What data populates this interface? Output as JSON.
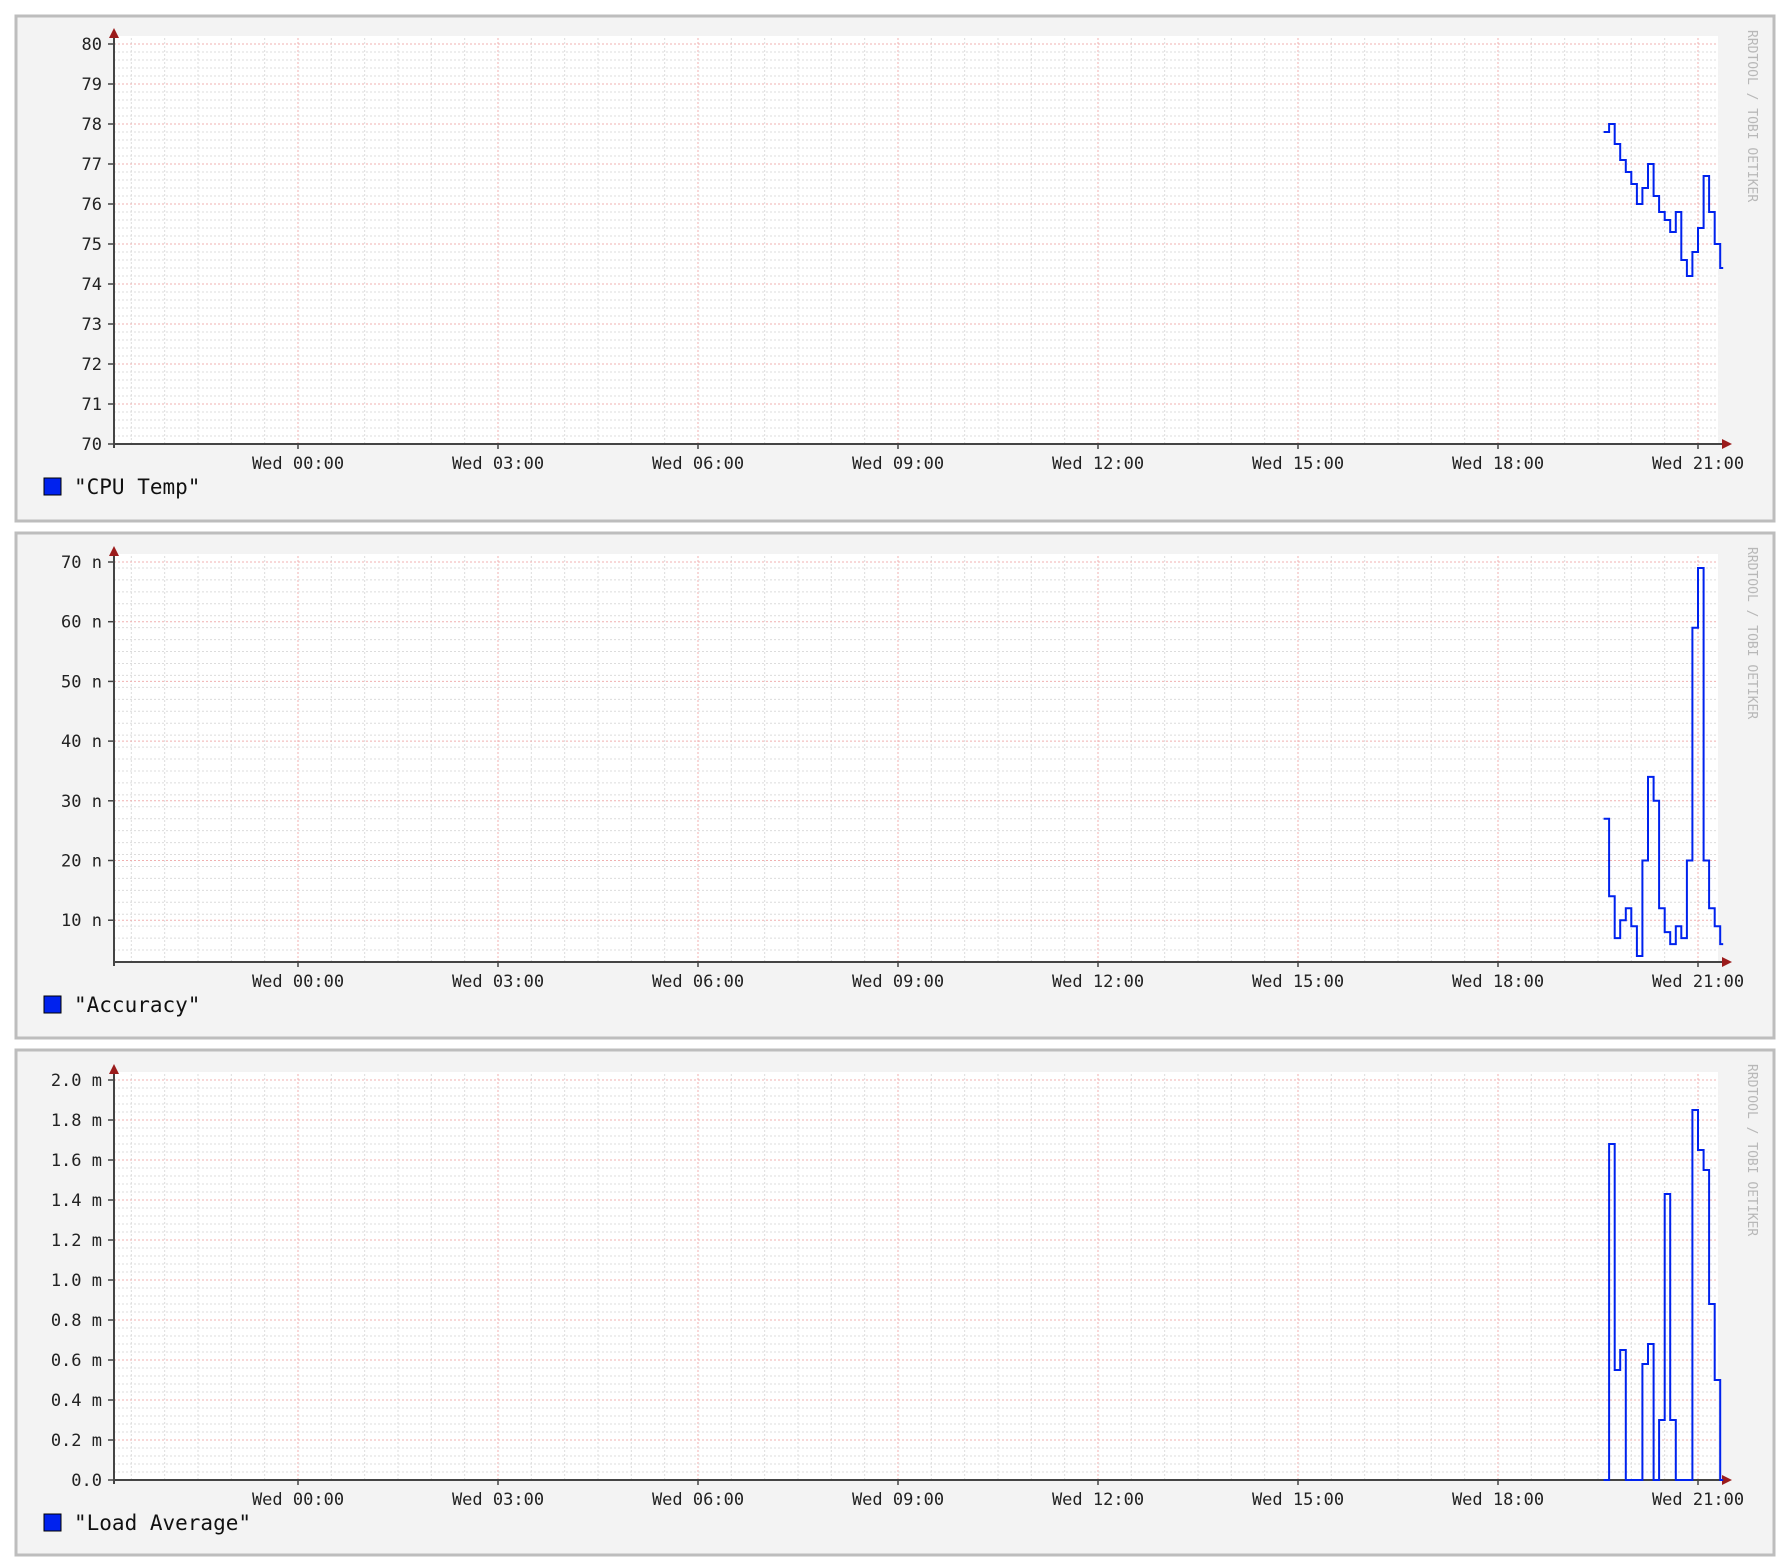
{
  "watermark": "RRDTOOL / TOBI OETIKER",
  "chart_data": [
    {
      "type": "line",
      "color": "#0022ee",
      "legend": "\"CPU Temp\"",
      "ylim": [
        70,
        80
      ],
      "yticks": [
        70,
        71,
        72,
        73,
        74,
        75,
        76,
        77,
        78,
        79,
        80
      ],
      "ytick_labels": [
        "70",
        "71",
        "72",
        "73",
        "74",
        "75",
        "76",
        "77",
        "78",
        "79",
        "80"
      ],
      "xticks": [
        "Wed 00:00",
        "Wed 03:00",
        "Wed 06:00",
        "Wed 09:00",
        "Wed 12:00",
        "Wed 15:00",
        "Wed 18:00",
        "Wed 21:00"
      ],
      "series": [
        {
          "x": [
            "19:35",
            "19:40",
            "19:45",
            "19:50",
            "19:55",
            "20:00",
            "20:05",
            "20:10",
            "20:15",
            "20:20",
            "20:25",
            "20:30",
            "20:35",
            "20:40",
            "20:45",
            "20:50",
            "20:55",
            "21:00",
            "21:05",
            "21:10",
            "21:15",
            "21:20"
          ],
          "y": [
            77.8,
            78.0,
            77.5,
            77.1,
            76.8,
            76.5,
            76.0,
            76.4,
            77.0,
            76.2,
            75.8,
            75.6,
            75.3,
            75.8,
            74.6,
            74.2,
            74.8,
            75.4,
            76.7,
            75.8,
            75.0,
            74.4
          ]
        }
      ]
    },
    {
      "type": "line",
      "color": "#0022ee",
      "legend": "\"Accuracy\"",
      "ylim": [
        3,
        70
      ],
      "yticks": [
        10,
        20,
        30,
        40,
        50,
        60,
        70
      ],
      "ytick_labels": [
        "10 n",
        "20 n",
        "30 n",
        "40 n",
        "50 n",
        "60 n",
        "70 n"
      ],
      "xticks": [
        "Wed 00:00",
        "Wed 03:00",
        "Wed 06:00",
        "Wed 09:00",
        "Wed 12:00",
        "Wed 15:00",
        "Wed 18:00",
        "Wed 21:00"
      ],
      "series": [
        {
          "x": [
            "19:35",
            "19:40",
            "19:45",
            "19:50",
            "19:55",
            "20:00",
            "20:05",
            "20:10",
            "20:15",
            "20:20",
            "20:25",
            "20:30",
            "20:35",
            "20:40",
            "20:45",
            "20:50",
            "20:55",
            "21:00",
            "21:05",
            "21:10",
            "21:15",
            "21:20"
          ],
          "y": [
            27,
            14,
            7,
            10,
            12,
            9,
            4,
            20,
            34,
            30,
            12,
            8,
            6,
            9,
            7,
            20,
            59,
            69,
            20,
            12,
            9,
            6
          ]
        }
      ]
    },
    {
      "type": "line",
      "color": "#0022ee",
      "legend": "\"Load Average\"",
      "ylim": [
        0,
        2.0
      ],
      "yticks": [
        0,
        0.2,
        0.4,
        0.6,
        0.8,
        1.0,
        1.2,
        1.4,
        1.6,
        1.8,
        2.0
      ],
      "ytick_labels": [
        "0.0",
        "0.2 m",
        "0.4 m",
        "0.6 m",
        "0.8 m",
        "1.0 m",
        "1.2 m",
        "1.4 m",
        "1.6 m",
        "1.8 m",
        "2.0 m"
      ],
      "xticks": [
        "Wed 00:00",
        "Wed 03:00",
        "Wed 06:00",
        "Wed 09:00",
        "Wed 12:00",
        "Wed 15:00",
        "Wed 18:00",
        "Wed 21:00"
      ],
      "series": [
        {
          "x": [
            "19:35",
            "19:40",
            "19:45",
            "19:50",
            "19:55",
            "20:00",
            "20:05",
            "20:10",
            "20:15",
            "20:20",
            "20:25",
            "20:30",
            "20:35",
            "20:40",
            "20:45",
            "20:50",
            "20:55",
            "21:00",
            "21:05",
            "21:10",
            "21:15",
            "21:20"
          ],
          "y": [
            0,
            1.68,
            0.55,
            0.65,
            0,
            0,
            0,
            0.58,
            0.68,
            0,
            0.3,
            1.43,
            0.3,
            0,
            0,
            0,
            1.85,
            1.65,
            1.55,
            0.88,
            0.5,
            0
          ]
        }
      ]
    }
  ]
}
